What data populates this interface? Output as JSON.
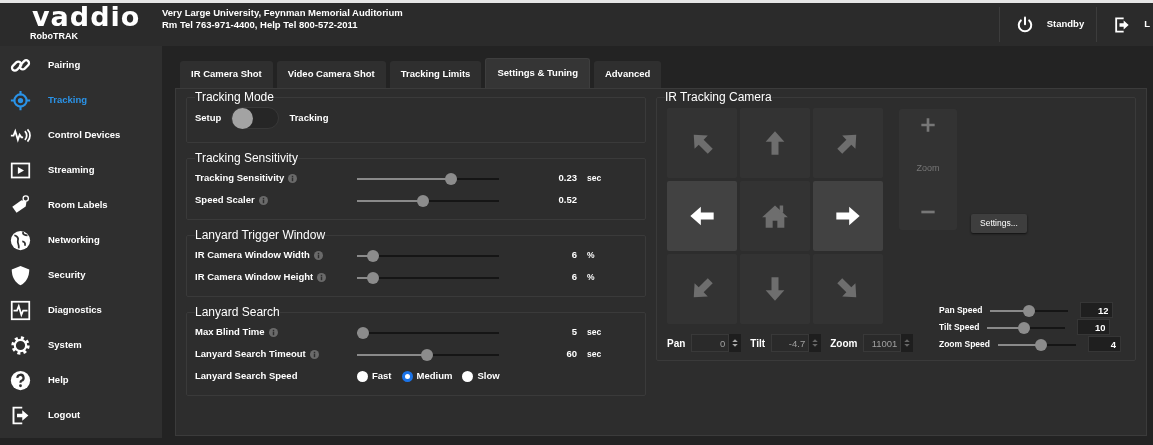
{
  "header": {
    "logo": "vaddio",
    "product": "RoboTRAK",
    "title": "Very Large University, Feynman Memorial Auditorium",
    "subtitle": "Rm Tel 763-971-4400, Help Tel 800-572-2011",
    "buttons": [
      {
        "label": "Standby"
      },
      {
        "label": "L"
      }
    ]
  },
  "sidebar": {
    "items": [
      {
        "label": "Pairing",
        "selected": false
      },
      {
        "label": "Tracking",
        "selected": true
      },
      {
        "label": "Control Devices",
        "selected": false
      },
      {
        "label": "Streaming",
        "selected": false
      },
      {
        "label": "Room Labels",
        "selected": false
      },
      {
        "label": "Networking",
        "selected": false
      },
      {
        "label": "Security",
        "selected": false
      },
      {
        "label": "Diagnostics",
        "selected": false
      },
      {
        "label": "System",
        "selected": false
      },
      {
        "label": "Help",
        "selected": false
      },
      {
        "label": "Logout",
        "selected": false
      }
    ]
  },
  "tabs": [
    {
      "label": "IR Camera Shot",
      "selected": false
    },
    {
      "label": "Video Camera Shot",
      "selected": false
    },
    {
      "label": "Tracking Limits",
      "selected": false
    },
    {
      "label": "Settings & Tuning",
      "selected": true
    },
    {
      "label": "Advanced",
      "selected": false
    }
  ],
  "tracking_mode": {
    "title": "Tracking Mode",
    "off_label": "Setup",
    "on_label": "Tracking",
    "on": false
  },
  "sections": [
    {
      "title": "Tracking Sensitivity",
      "rows": [
        {
          "kind": "slider",
          "label": "Tracking Sensitivity",
          "level": 0.68,
          "value": "0.23",
          "unit": "sec"
        },
        {
          "kind": "slider",
          "label": "Speed Scaler",
          "level": 0.46,
          "value": "0.52"
        }
      ]
    },
    {
      "title": "Lanyard Trigger Window",
      "rows": [
        {
          "kind": "slider",
          "label": "IR Camera Window Width",
          "level": 0.08,
          "value": "6",
          "unit": "%"
        },
        {
          "kind": "slider",
          "label": "IR Camera Window Height",
          "level": 0.08,
          "value": "6",
          "unit": "%"
        }
      ]
    },
    {
      "title": "Lanyard Search",
      "rows": [
        {
          "kind": "slider",
          "label": "Max Blind Time",
          "level": 0,
          "value": "5",
          "unit": "sec"
        },
        {
          "kind": "slider",
          "label": "Lanyard Search Timeout",
          "level": 0.49,
          "value": "60",
          "unit": "sec"
        },
        {
          "kind": "radio",
          "label": "Lanyard Search Speed",
          "options": [
            {
              "label": "Fast",
              "selected": false
            },
            {
              "label": "Medium",
              "selected": true
            },
            {
              "label": "Slow",
              "selected": false
            }
          ]
        }
      ]
    }
  ],
  "camera": {
    "title": "IR Tracking Camera",
    "directions": [
      {
        "disabled": true
      },
      {
        "disabled": true
      },
      {
        "disabled": true
      },
      {
        "disabled": false
      },
      {
        "disabled": true
      },
      {
        "disabled": false
      },
      {
        "disabled": true
      },
      {
        "disabled": true
      },
      {
        "disabled": true
      }
    ],
    "zoom": {
      "label": "Zoom",
      "disabled": true
    },
    "settings_button": "Settings...",
    "positions": [
      {
        "label": "Pan",
        "value": "0",
        "disabled": true
      },
      {
        "label": "Tilt",
        "value": "-4.7",
        "disabled": true
      },
      {
        "label": "Zoom",
        "value": "11001",
        "disabled": true
      }
    ],
    "speeds": [
      {
        "label": "Pan Speed",
        "level": 0.49,
        "value": "12"
      },
      {
        "label": "Tilt Speed",
        "level": 0.46,
        "value": "10"
      },
      {
        "label": "Zoom Speed",
        "level": 0.56,
        "value": "4"
      }
    ]
  }
}
